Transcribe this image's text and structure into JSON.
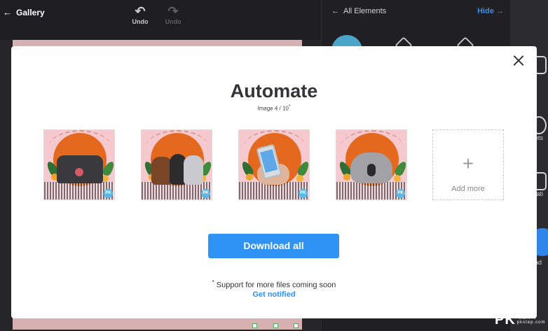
{
  "topbar": {
    "back_label": "Gallery",
    "undo_label": "Undo",
    "redo_label": "Undo"
  },
  "panel": {
    "title": "All Elements",
    "hide_label": "Hide"
  },
  "rail": {
    "items": [
      "d",
      "ents",
      "mati",
      "oad"
    ]
  },
  "modal": {
    "title": "Automate",
    "subtitle": "Image 4 / 10",
    "subtitle_mark": "*",
    "thumbnails": [
      {
        "subject": "people",
        "badge": "PK"
      },
      {
        "subject": "horses",
        "badge": "PK"
      },
      {
        "subject": "phone",
        "badge": "PK"
      },
      {
        "subject": "koala",
        "badge": "PK"
      }
    ],
    "add_more_label": "Add more",
    "download_label": "Download all",
    "note_mark": "*",
    "note_text": "Support for more files coming soon",
    "notify_label": "Get notified"
  },
  "watermark": {
    "text": "PK",
    "small_line1": "電腦應用",
    "small_line2": "pkstep.com"
  },
  "colors": {
    "accent": "#2e93f5",
    "thumb_bg": "#f6c9cf",
    "sun": "#e4691f",
    "canvas_pink": "#d7b0b1"
  }
}
